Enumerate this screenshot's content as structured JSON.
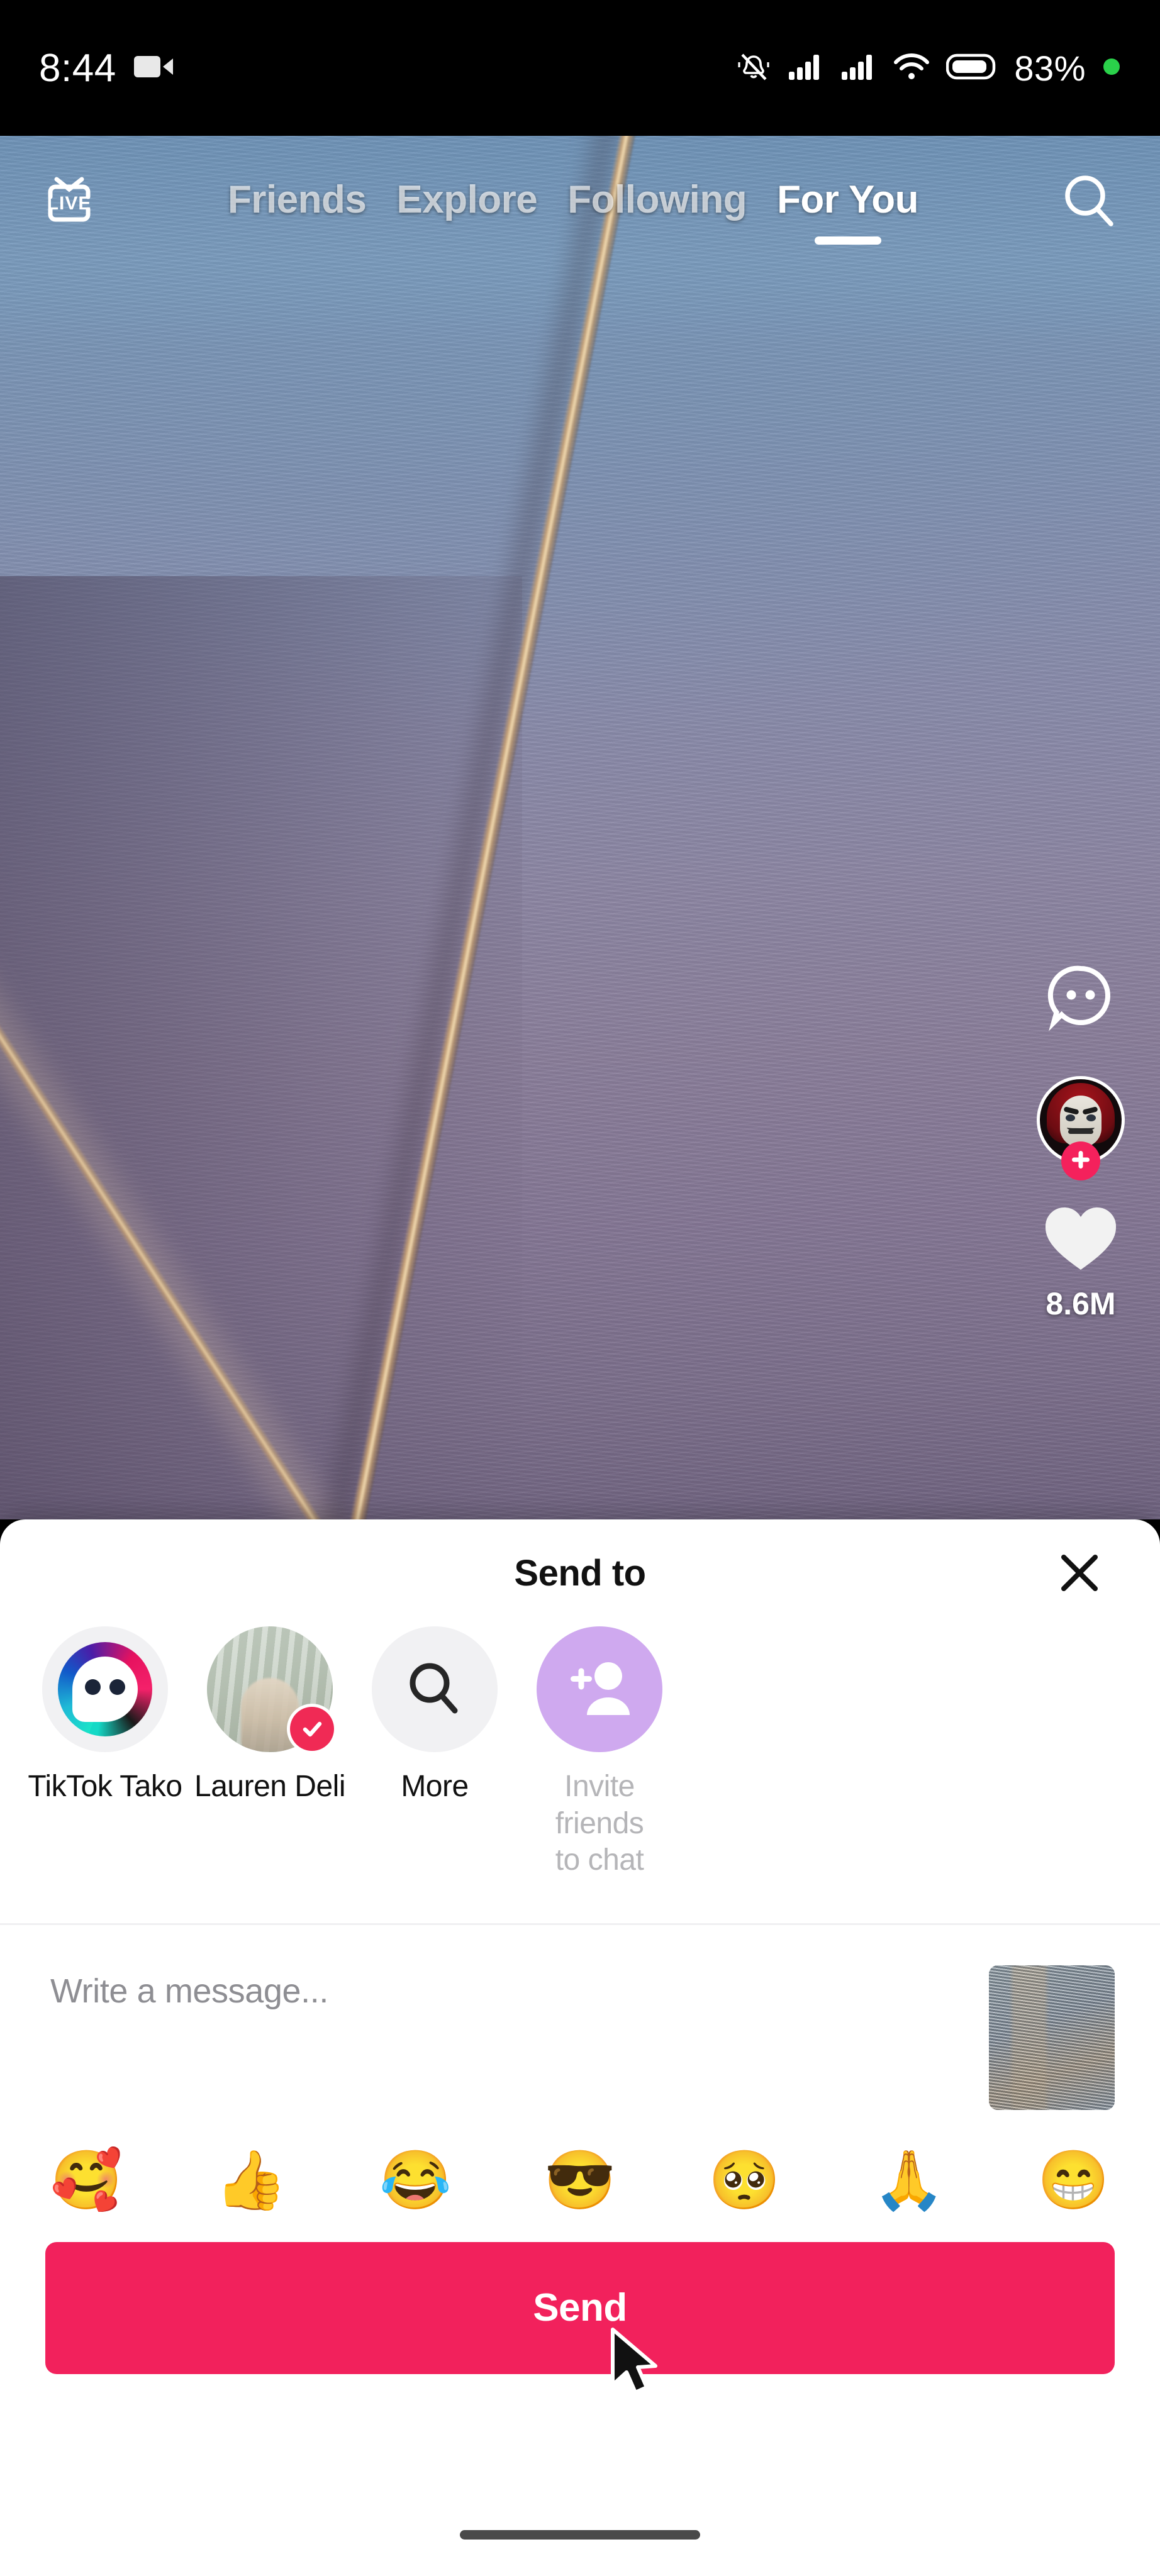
{
  "status_bar": {
    "time": "8:44",
    "icons": [
      "video-recording-icon",
      "bell-muted-icon",
      "signal-1-icon",
      "signal-2-icon",
      "wifi-icon",
      "battery-icon",
      "green-dot-icon"
    ],
    "battery_percent": "83%",
    "battery_percent_value": "83",
    "battery_percent_symbol": "%"
  },
  "top_nav": {
    "live_label": "LIVE",
    "tabs": [
      {
        "label": "Friends",
        "active": false
      },
      {
        "label": "Explore",
        "active": false
      },
      {
        "label": "Following",
        "active": false
      },
      {
        "label": "For You",
        "active": true
      }
    ],
    "search_icon": "search-icon"
  },
  "video_rail": {
    "comment_icon": "comment-bubble-icon",
    "avatar_alt": "creator-avatar",
    "follow_icon": "plus-icon",
    "like_icon": "heart-icon",
    "like_count": "8.6M"
  },
  "share_sheet": {
    "title": "Send to",
    "close_icon": "close-icon",
    "contacts": [
      {
        "name": "TikTok Tako",
        "type": "tako",
        "muted": false,
        "selected": false
      },
      {
        "name": "Lauren Deli",
        "type": "photo",
        "muted": false,
        "selected": true
      },
      {
        "name": "More",
        "type": "search",
        "muted": false,
        "selected": false
      },
      {
        "name": "Invite friends\nto chat",
        "name_line1": "Invite friends",
        "name_line2": "to chat",
        "type": "invite",
        "muted": true,
        "selected": false
      }
    ],
    "message": {
      "placeholder": "Write a message...",
      "value": "",
      "attachment": "video-thumbnail"
    },
    "emojis": [
      "🥰",
      "👍",
      "😂",
      "😎",
      "🥺",
      "🙏",
      "😁"
    ],
    "send_label": "Send"
  },
  "system": {
    "home_indicator": "home-indicator",
    "cursor": "mouse-pointer"
  },
  "colors": {
    "accent_pink": "#f2215c",
    "check_pink": "#f02a55",
    "invite_purple": "#cfa9ef",
    "sheet_bg": "#ffffff",
    "status_bg": "#000000",
    "battery_dot_green": "#2ad14a"
  }
}
